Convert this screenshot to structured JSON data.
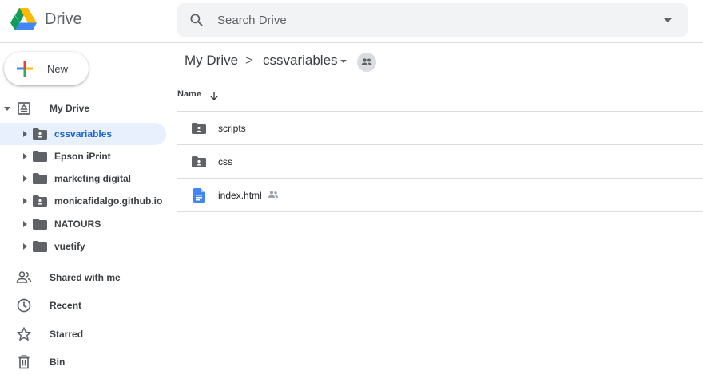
{
  "header": {
    "app_title": "Drive",
    "search_placeholder": "Search Drive"
  },
  "sidebar": {
    "new_label": "New",
    "my_drive_label": "My Drive",
    "folders": [
      {
        "label": "cssvariables",
        "shared": true,
        "selected": true
      },
      {
        "label": "Epson iPrint",
        "shared": false,
        "selected": false
      },
      {
        "label": "marketing digital",
        "shared": false,
        "selected": false
      },
      {
        "label": "monicafidalgo.github.io",
        "shared": true,
        "selected": false
      },
      {
        "label": "NATOURS",
        "shared": false,
        "selected": false
      },
      {
        "label": "vuetify",
        "shared": false,
        "selected": false
      }
    ],
    "nav": [
      {
        "label": "Shared with me",
        "icon": "shared-with-me-icon"
      },
      {
        "label": "Recent",
        "icon": "clock-icon"
      },
      {
        "label": "Starred",
        "icon": "star-icon"
      },
      {
        "label": "Bin",
        "icon": "trash-icon"
      }
    ]
  },
  "breadcrumb": {
    "root": "My Drive",
    "separator": ">",
    "current": "cssvariables"
  },
  "list": {
    "column_name": "Name",
    "files": [
      {
        "name": "scripts",
        "type": "shared-folder"
      },
      {
        "name": "css",
        "type": "shared-folder"
      },
      {
        "name": "index.html",
        "type": "doc",
        "shared": true
      }
    ]
  },
  "colors": {
    "accent": "#1967d2",
    "selected_bg": "#e8f0fe",
    "icon_grey": "#5f6368",
    "doc_blue": "#4285f4"
  }
}
